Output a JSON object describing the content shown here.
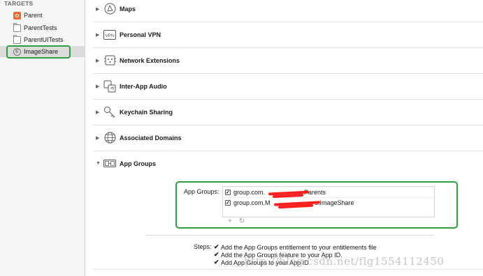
{
  "sidebar": {
    "header": "TARGETS",
    "items": [
      {
        "label": "Parent",
        "icon": "app-target-icon"
      },
      {
        "label": "ParentTests",
        "icon": "folder-icon"
      },
      {
        "label": "ParentUITests",
        "icon": "folder-icon"
      },
      {
        "label": "ImageShare",
        "icon": "extension-icon",
        "selected": true
      }
    ]
  },
  "capabilities": [
    {
      "label": "Maps",
      "icon": "maps-icon"
    },
    {
      "label": "Personal VPN",
      "icon": "vpn-icon"
    },
    {
      "label": "Network Extensions",
      "icon": "network-extensions-icon"
    },
    {
      "label": "Inter-App Audio",
      "icon": "inter-app-audio-icon"
    },
    {
      "label": "Keychain Sharing",
      "icon": "keychain-icon"
    },
    {
      "label": "Associated Domains",
      "icon": "globe-icon"
    },
    {
      "label": "App Groups",
      "icon": "app-groups-icon",
      "expanded": true
    }
  ],
  "app_groups": {
    "label": "App Groups:",
    "items": [
      {
        "prefix": "group.com.",
        "suffix": "Parents",
        "checked": true
      },
      {
        "prefix": "group.com.M",
        "suffix": "s.ImageShare",
        "checked": true
      }
    ],
    "add_button": "+",
    "refresh_button": "↻"
  },
  "steps": {
    "label": "Steps:",
    "items": [
      "Add the App Groups entitlement to your entitlements file",
      "Add the App Groups feature to your App ID.",
      "Add App Groups to your App ID"
    ]
  },
  "watermark": "http://blog.csdn.net/flg1554112450",
  "colors": {
    "highlight": "#2e9e3c",
    "redaction": "#ff2020",
    "sidebar_bg": "#f6f6f6"
  }
}
